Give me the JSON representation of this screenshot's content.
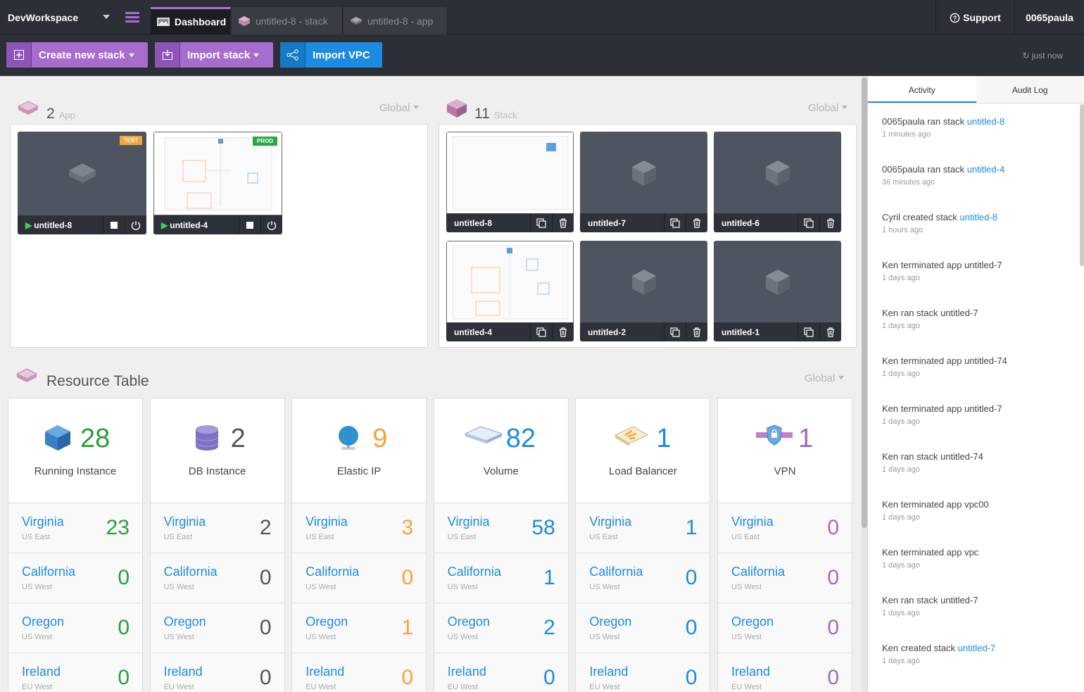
{
  "topbar": {
    "workspace": "DevWorkspace",
    "tabs": [
      {
        "label": "Dashboard"
      },
      {
        "label": "untitled-8 - stack"
      },
      {
        "label": "untitled-8 - app"
      }
    ],
    "support_label": "Support",
    "user": "0065paula"
  },
  "toolbar": {
    "create_label": "Create new stack",
    "import_label": "Import stack",
    "vpc_label": "Import VPC",
    "refresh_label": "just now"
  },
  "apps": {
    "count": "2",
    "label": "App",
    "filter": "Global",
    "items": [
      {
        "name": "untitled-8",
        "badge": "TEST"
      },
      {
        "name": "untitled-4",
        "badge": "PROD"
      }
    ]
  },
  "stacks": {
    "count": "11",
    "label": "Stack",
    "filter": "Global",
    "items": [
      {
        "name": "untitled-8"
      },
      {
        "name": "untitled-7"
      },
      {
        "name": "untitled-6"
      },
      {
        "name": "untitled-4"
      },
      {
        "name": "untitled-2"
      },
      {
        "name": "untitled-1"
      }
    ]
  },
  "resources": {
    "title": "Resource Table",
    "filter": "Global",
    "colors": {
      "green": "#2a9d3a",
      "gray": "#555555",
      "orange": "#f5a23a",
      "blue": "#1d8be0",
      "purple": "#9b6cc4"
    },
    "columns": [
      {
        "name": "Running Instance",
        "total": "28",
        "color": "green",
        "values": [
          "23",
          "0",
          "0",
          "0"
        ]
      },
      {
        "name": "DB Instance",
        "total": "2",
        "color": "gray",
        "values": [
          "2",
          "0",
          "0",
          "0"
        ]
      },
      {
        "name": "Elastic IP",
        "total": "9",
        "color": "orange",
        "values": [
          "3",
          "0",
          "1",
          "0"
        ]
      },
      {
        "name": "Volume",
        "total": "82",
        "color": "blue",
        "values": [
          "58",
          "1",
          "2",
          "0"
        ]
      },
      {
        "name": "Load Balancer",
        "total": "1",
        "color": "blue",
        "values": [
          "1",
          "0",
          "0",
          "0"
        ]
      },
      {
        "name": "VPN",
        "total": "1",
        "color": "purple",
        "values": [
          "0",
          "0",
          "0",
          "0"
        ]
      }
    ],
    "regions": [
      {
        "name": "Virginia",
        "sub": "US East"
      },
      {
        "name": "California",
        "sub": "US West"
      },
      {
        "name": "Oregon",
        "sub": "US West"
      },
      {
        "name": "Ireland",
        "sub": "EU West"
      }
    ]
  },
  "activity": {
    "tabs": [
      "Activity",
      "Audit Log"
    ],
    "items": [
      {
        "text": "0065paula ran stack ",
        "link": "untitled-8",
        "time": "1 minutes ago"
      },
      {
        "text": "0065paula ran stack ",
        "link": "untitled-4",
        "time": "36 minutes ago"
      },
      {
        "text": "Cyril created stack ",
        "link": "untitled-8",
        "time": "1 hours ago"
      },
      {
        "text": "Ken terminated app untitled-7",
        "link": "",
        "time": "1 days ago"
      },
      {
        "text": "Ken ran stack untitled-7",
        "link": "",
        "time": "1 days ago"
      },
      {
        "text": "Ken terminated app untitled-74",
        "link": "",
        "time": "1 days ago"
      },
      {
        "text": "Ken terminated app untitled-7",
        "link": "",
        "time": "1 days ago"
      },
      {
        "text": "Ken ran stack untitled-74",
        "link": "",
        "time": "1 days ago"
      },
      {
        "text": "Ken terminated app vpc00",
        "link": "",
        "time": "1 days ago"
      },
      {
        "text": "Ken terminated app vpc",
        "link": "",
        "time": "1 days ago"
      },
      {
        "text": "Ken ran stack untitled-7",
        "link": "",
        "time": "1 days ago"
      },
      {
        "text": "Ken created stack ",
        "link": "untitled-7",
        "time": "1 days ago"
      }
    ]
  }
}
